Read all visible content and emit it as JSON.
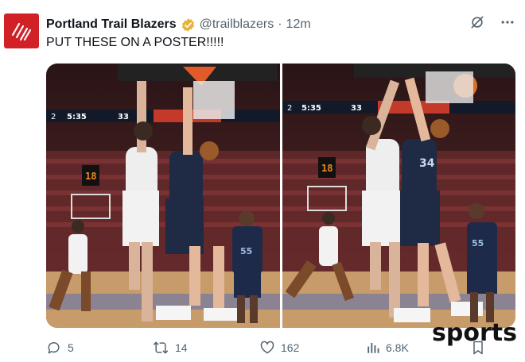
{
  "account": {
    "display_name": "Portland Trail Blazers",
    "handle": "@trailblazers",
    "separator": "·",
    "timestamp": "12m",
    "verified_icon": "verified-badge-icon",
    "brand_color": "#d22027"
  },
  "tweet": {
    "text": "PUT THESE ON A POSTER!!!!!"
  },
  "media": {
    "photos": [
      {
        "scoreboard": {
          "time": "5:35",
          "period": "2",
          "score": "33",
          "shot_clock": "18"
        },
        "jersey_visible": "55"
      },
      {
        "scoreboard": {
          "time": "5:35",
          "period": "2",
          "score": "33",
          "shot_clock": "18"
        },
        "jersey_visible": "55",
        "jersey_secondary": "34"
      }
    ]
  },
  "actions": {
    "replies": "5",
    "retweets": "14",
    "likes": "162",
    "views": "6.8K"
  },
  "watermark": "sports",
  "colors": {
    "text": "#0f1419",
    "muted": "#536471",
    "verified": "#e8b339"
  }
}
